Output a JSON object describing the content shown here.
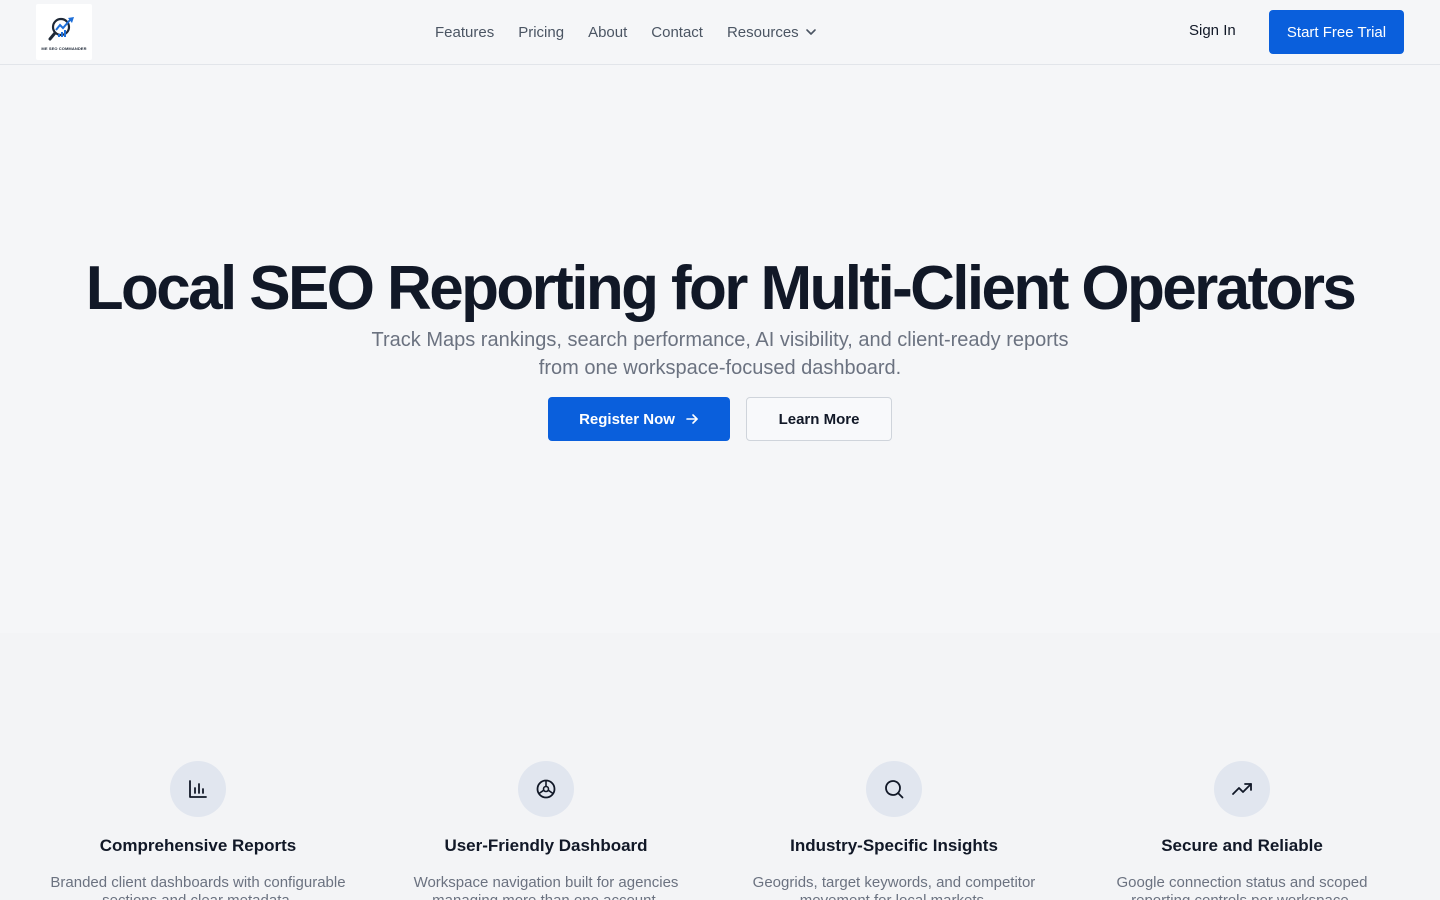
{
  "header": {
    "logo_text": "ME SEO COMMANDER",
    "nav": [
      {
        "label": "Features"
      },
      {
        "label": "Pricing"
      },
      {
        "label": "About"
      },
      {
        "label": "Contact"
      },
      {
        "label": "Resources",
        "icon": "chevron-down-icon"
      }
    ],
    "sign_in": "Sign In",
    "trial": "Start Free Trial"
  },
  "hero": {
    "title": "Local SEO Reporting for Multi-Client Operators",
    "subtitle": "Track Maps rankings, search performance, AI visibility, and client-ready reports from one workspace-focused dashboard.",
    "primary_cta": "Register Now",
    "primary_cta_icon": "arrow-right-icon",
    "secondary_cta": "Learn More"
  },
  "features": [
    {
      "icon": "bar-chart-icon",
      "title": "Comprehensive Reports",
      "desc": "Branded client dashboards with configurable sections and clear metadata."
    },
    {
      "icon": "dashboard-dial-icon",
      "title": "User-Friendly Dashboard",
      "desc": "Workspace navigation built for agencies managing more than one account."
    },
    {
      "icon": "search-icon",
      "title": "Industry-Specific Insights",
      "desc": "Geogrids, target keywords, and competitor movement for local markets."
    },
    {
      "icon": "trending-up-icon",
      "title": "Secure and Reliable",
      "desc": "Google connection status and scoped reporting controls per workspace."
    }
  ],
  "colors": {
    "accent": "#0a5fdc",
    "background": "#f5f6f8",
    "icon_circle": "#e1e6ef",
    "heading": "#111827",
    "muted": "#6b7280"
  }
}
